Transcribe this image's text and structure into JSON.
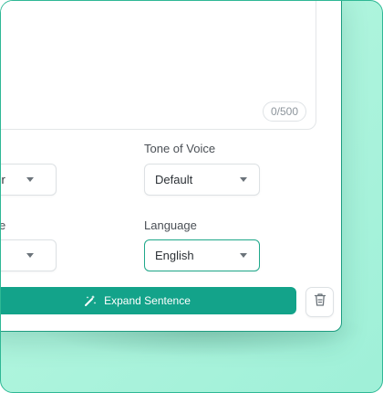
{
  "editor": {
    "char_counter": "0/500"
  },
  "fields": {
    "left_select_1_value": "ger",
    "tone_label": "Tone of Voice",
    "tone_value": "Default",
    "left_label_2": "ence",
    "language_label": "Language",
    "language_value": "English"
  },
  "actions": {
    "expand_label": "Expand Sentence"
  },
  "colors": {
    "accent": "#13a38a",
    "focus_border": "#1fa88a",
    "background": "#aef4dd"
  },
  "icons": {
    "expand": "magic-wand-icon",
    "delete": "trash-icon",
    "dropdown": "caret-down-icon"
  }
}
